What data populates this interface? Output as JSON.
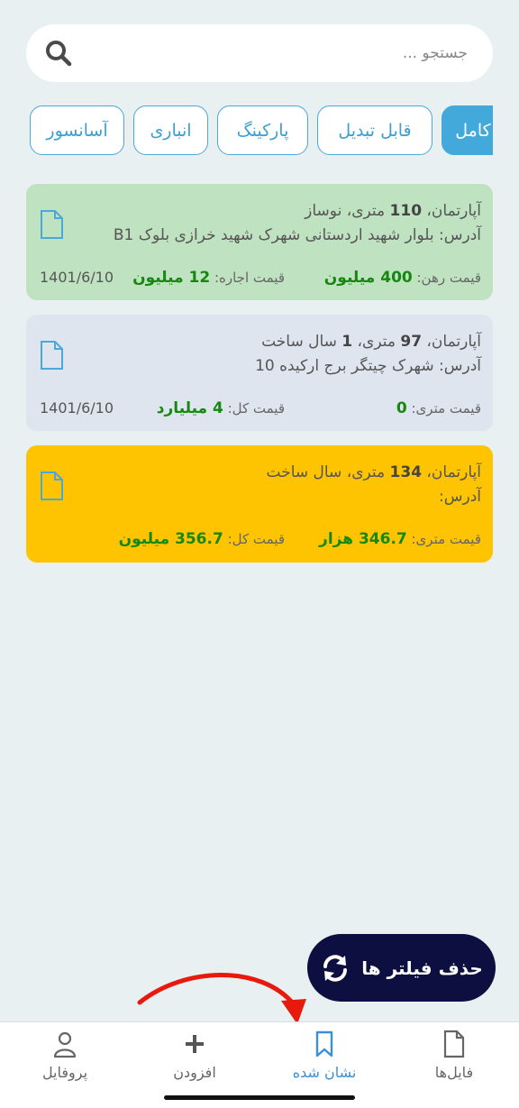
{
  "search": {
    "placeholder": "جستجو ..."
  },
  "filters": [
    {
      "label": "کامل",
      "active": true
    },
    {
      "label": "قابل تبدیل",
      "active": false
    },
    {
      "label": "پارکینگ",
      "active": false
    },
    {
      "label": "انباری",
      "active": false
    },
    {
      "label": "آسانسور",
      "active": false
    }
  ],
  "cards": [
    {
      "bg": "#bfe2c1",
      "title_prefix": "آپارتمان، ",
      "area": "110",
      "title_suffix": " متری، نوساز",
      "address": "آدرس: بلوار شهید اردستانی شهرک شهید خرازی بلوک B1",
      "price1_label": "قیمت رهن: ",
      "price1_value": "400 میلیون",
      "price2_label": "قیمت اجاره: ",
      "price2_value": "12 میلیون",
      "date": "1401/6/10"
    },
    {
      "bg": "#dfe5ee",
      "title_prefix": "آپارتمان، ",
      "area": "97",
      "title_suffix": " متری، ",
      "age": "1",
      "title_suffix2": " سال ساخت",
      "address": "آدرس: شهرک چیتگر برج ارکیده 10",
      "price1_label": "قیمت متری: ",
      "price1_value": "0",
      "price2_label": "قیمت کل: ",
      "price2_value": "4 میلیارد",
      "date": "1401/6/10"
    },
    {
      "bg": "#fec401",
      "title_prefix": "آپارتمان، ",
      "area": "134",
      "title_suffix": " متری،  سال ساخت",
      "address": "آدرس:",
      "price1_label": "قیمت متری: ",
      "price1_value": "346.7 هزار",
      "price2_label": "قیمت کل: ",
      "price2_value": "356.7 میلیون",
      "date": ""
    }
  ],
  "fab": {
    "label": "حذف فیلتر ها"
  },
  "nav": [
    {
      "label": "فایل‌ها",
      "icon": "file-icon"
    },
    {
      "label": "نشان شده",
      "icon": "bookmark-icon",
      "active": true
    },
    {
      "label": "افزودن",
      "icon": "plus-icon"
    },
    {
      "label": "پروفایل",
      "icon": "user-icon"
    }
  ],
  "colors": {
    "accent": "#43a8da",
    "price_green": "#16880f",
    "fab_bg": "#0c0f3f"
  }
}
